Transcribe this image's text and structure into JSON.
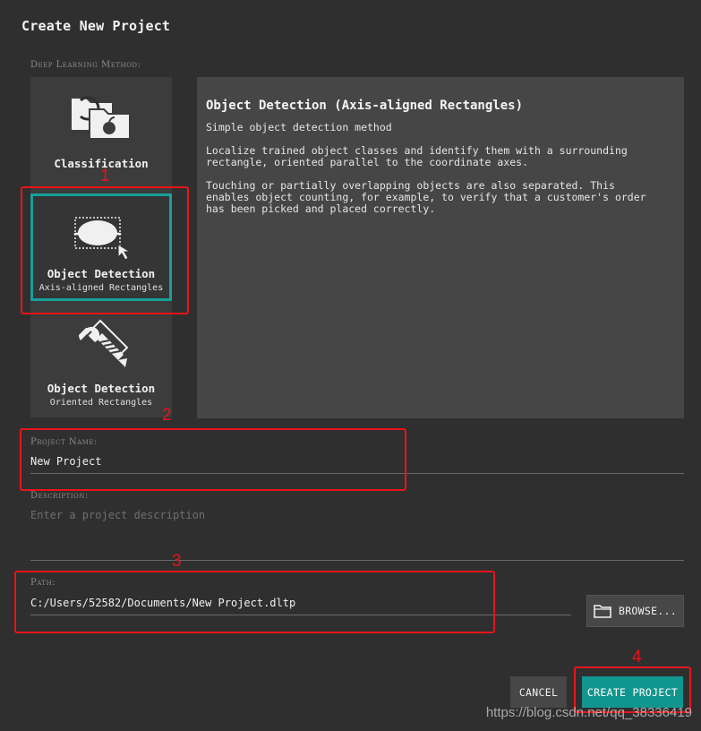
{
  "dialog": {
    "title": "Create New Project"
  },
  "methods": {
    "label": "Deep Learning Method:",
    "items": [
      {
        "name": "Classification",
        "sub": "",
        "icon": "folder-apple-icon"
      },
      {
        "name": "Object Detection",
        "sub": "Axis-aligned Rectangles",
        "icon": "lemon-selection-icon",
        "selected": true
      },
      {
        "name": "Object Detection",
        "sub": "Oriented Rectangles",
        "icon": "rotated-screw-icon"
      }
    ]
  },
  "description_panel": {
    "title": "Object Detection (Axis-aligned Rectangles)",
    "paragraphs": [
      "Simple object detection method",
      "Localize trained object classes and identify them with a surrounding\nrectangle, oriented parallel to the coordinate axes.",
      "Touching or partially overlapping objects are also separated. This\nenables object counting, for example, to verify that a customer's order\nhas been picked and placed correctly."
    ]
  },
  "project_name": {
    "label": "Project Name:",
    "value": "New Project"
  },
  "description": {
    "label": "Description:",
    "placeholder": "Enter a project description"
  },
  "path": {
    "label": "Path:",
    "value": "C:/Users/52582/Documents/New Project.dltp",
    "browse_label": "BROWSE..."
  },
  "actions": {
    "cancel_label": "CANCEL",
    "create_label": "CREATE PROJECT"
  },
  "annotations": {
    "n1": "1",
    "n2": "2",
    "n3": "3",
    "n4": "4",
    "color": "#e8141a"
  },
  "watermark": "https://blog.csdn.net/qq_38336419",
  "accent_color": "#11968f"
}
